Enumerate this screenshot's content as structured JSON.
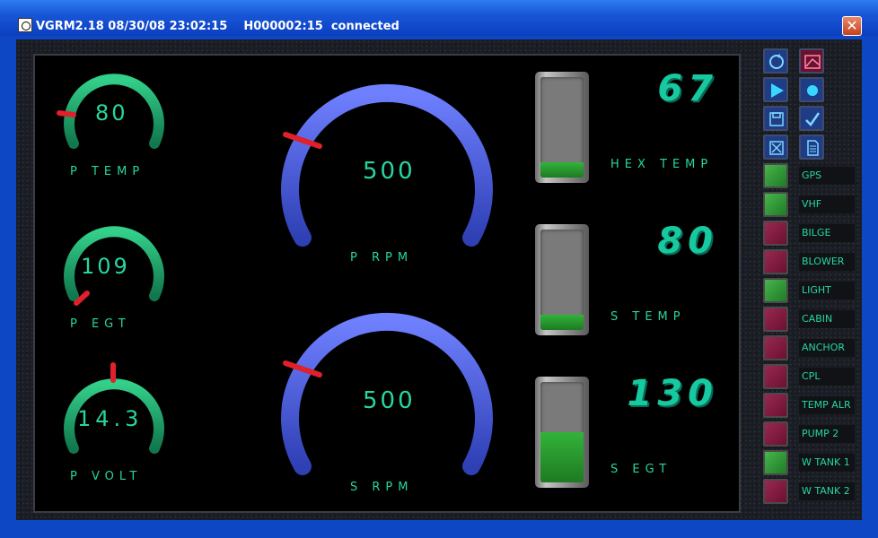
{
  "window": {
    "title": "VGRM2.18 08/30/08 23:02:15    H000002:15  connected",
    "close_glyph": "✕"
  },
  "small_gauges": [
    {
      "value": "80",
      "label": "P TEMP"
    },
    {
      "value": "109",
      "label": "P EGT"
    },
    {
      "value": "14.3",
      "label": "P VOLT"
    }
  ],
  "rpm_gauges": [
    {
      "value": "500",
      "label": "P RPM"
    },
    {
      "value": "500",
      "label": "S RPM"
    }
  ],
  "tanks": [
    {
      "number": "67",
      "label": "HEX TEMP",
      "level": 0.15
    },
    {
      "number": "80",
      "label": "S TEMP",
      "level": 0.15
    },
    {
      "number": "130",
      "label": "S EGT",
      "level": 0.5
    }
  ],
  "toolbar": [
    {
      "icon": "refresh-icon"
    },
    {
      "icon": "chart-icon"
    },
    {
      "icon": "play-icon"
    },
    {
      "icon": "record-icon"
    },
    {
      "icon": "save-icon"
    },
    {
      "icon": "check-icon"
    },
    {
      "icon": "close-box-icon"
    },
    {
      "icon": "document-icon"
    }
  ],
  "switches": [
    {
      "label": "GPS",
      "state": "on"
    },
    {
      "label": "VHF",
      "state": "on"
    },
    {
      "label": "BILGE",
      "state": "off"
    },
    {
      "label": "BLOWER",
      "state": "off"
    },
    {
      "label": "LIGHT",
      "state": "on"
    },
    {
      "label": "CABIN",
      "state": "off"
    },
    {
      "label": "ANCHOR",
      "state": "off"
    },
    {
      "label": "CPL",
      "state": "off"
    },
    {
      "label": "TEMP ALR",
      "state": "off"
    },
    {
      "label": "PUMP 2",
      "state": "off"
    },
    {
      "label": "W TANK 1",
      "state": "on"
    },
    {
      "label": "W TANK 2",
      "state": "off"
    }
  ],
  "colors": {
    "gauge_green": "#1fa870",
    "gauge_blue": "#4a5ed8",
    "needle_red": "#e0202a",
    "digit_teal": "#26d6a0",
    "switch_on": "#2e9a35",
    "switch_off": "#85193f"
  }
}
